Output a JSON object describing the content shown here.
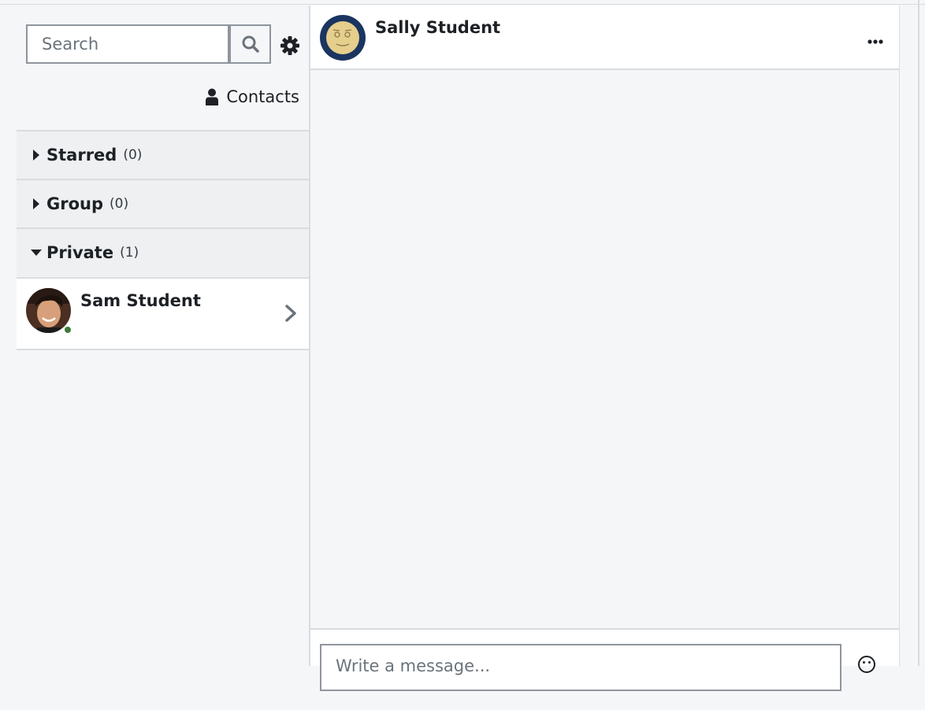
{
  "sidebar": {
    "search_placeholder": "Search",
    "contacts_label": "Contacts",
    "sections": [
      {
        "title": "Starred",
        "count": "(0)",
        "expanded": false
      },
      {
        "title": "Group",
        "count": "(0)",
        "expanded": false
      },
      {
        "title": "Private",
        "count": "(1)",
        "expanded": true
      }
    ],
    "private_contacts": [
      {
        "name": "Sam Student",
        "online": true
      }
    ]
  },
  "conversation": {
    "name": "Sally Student",
    "more_label": "•••",
    "message_placeholder": "Write a message..."
  },
  "colors": {
    "online": "#3d7c3b",
    "panel_bg": "#f5f6f8",
    "section_bg": "#eef0f2",
    "border": "#d9dcdf"
  }
}
